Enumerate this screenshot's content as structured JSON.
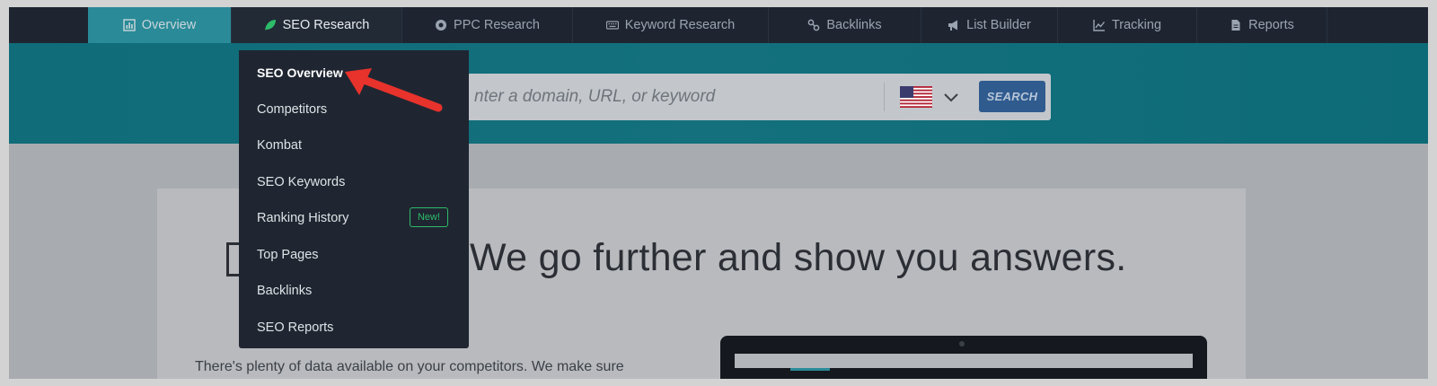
{
  "nav": {
    "items": [
      {
        "label": "Overview",
        "icon": "bar-chart-icon"
      },
      {
        "label": "SEO Research",
        "icon": "leaf-icon"
      },
      {
        "label": "PPC Research",
        "icon": "coin-icon"
      },
      {
        "label": "Keyword Research",
        "icon": "keyboard-icon"
      },
      {
        "label": "Backlinks",
        "icon": "link-icon"
      },
      {
        "label": "List Builder",
        "icon": "megaphone-icon"
      },
      {
        "label": "Tracking",
        "icon": "trend-chart-icon"
      },
      {
        "label": "Reports",
        "icon": "document-icon"
      }
    ]
  },
  "search": {
    "placeholder": "nter a domain, URL, or keyword",
    "button": "SEARCH",
    "country_icon": "us-flag-icon"
  },
  "dropdown": {
    "items": [
      "SEO Overview",
      "Competitors",
      "Kombat",
      "SEO Keywords",
      "Ranking History",
      "Top Pages",
      "Backlinks",
      "SEO Reports"
    ],
    "badge": "New!"
  },
  "content": {
    "headline": "We go further and show you answers.",
    "body": "There's plenty of data available on your competitors. We make sure"
  },
  "colors": {
    "nav_bg": "#1e2531",
    "overview_tab": "#2a8a98",
    "hero": "#126f7a",
    "search_button": "#2f5b8f",
    "accent_green": "#2dbb6a",
    "arrow": "#e8322c"
  }
}
